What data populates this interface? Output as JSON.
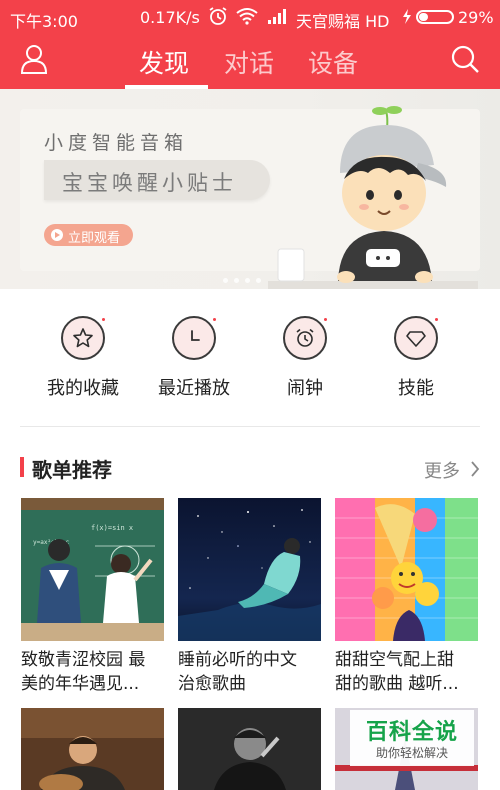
{
  "status_bar": {
    "time": "下午3:00",
    "speed": "0.17K/s",
    "carrier": "天官赐福 HD",
    "battery": "29%",
    "battery_level": 0.29
  },
  "nav": {
    "tabs": [
      "发现",
      "对话",
      "设备"
    ],
    "active_tab": "发现"
  },
  "banner": {
    "title": "小度智能音箱",
    "subtitle": "宝宝唤醒小贴士",
    "button": "立即观看"
  },
  "quick_actions": [
    {
      "label": "我的收藏",
      "icon": "star-icon"
    },
    {
      "label": "最近播放",
      "icon": "clock-icon"
    },
    {
      "label": "闹钟",
      "icon": "alarm-icon"
    },
    {
      "label": "技能",
      "icon": "diamond-icon"
    }
  ],
  "section": {
    "title": "歌单推荐",
    "more": "更多"
  },
  "playlists": [
    {
      "line1": "致敬青涩校园 最",
      "line2": "美的年华遇见..."
    },
    {
      "line1": "睡前必听的中文",
      "line2": "治愈歌曲"
    },
    {
      "line1": "甜甜空气配上甜",
      "line2": "甜的歌曲 越听..."
    }
  ],
  "watermark": {
    "title": "百科全说",
    "subtitle": "助你轻松解决"
  },
  "colors": {
    "brand": "#f3414a",
    "banner_button": "#f4a58f"
  }
}
